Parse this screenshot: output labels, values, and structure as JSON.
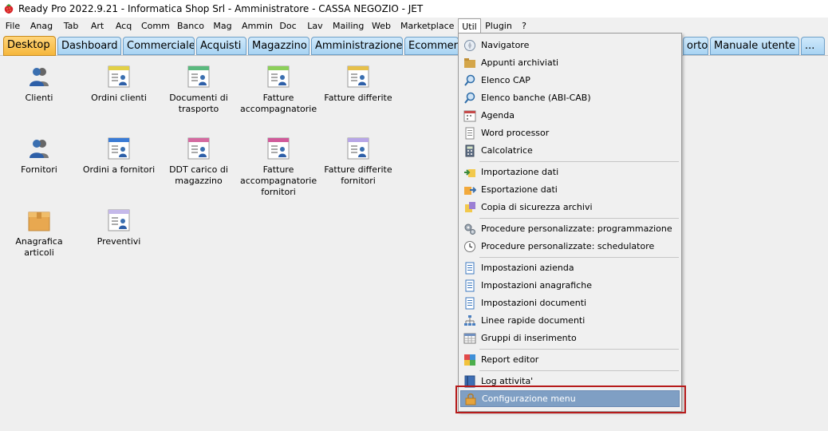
{
  "window": {
    "title": "Ready Pro 2022.9.21 - Informatica Shop Srl - Amministratore - CASSA NEGOZIO - JET"
  },
  "menubar": {
    "items": [
      "File",
      "Anag",
      "Tab",
      "Art",
      "Acq",
      "Comm",
      "Banco",
      "Mag",
      "Ammin",
      "Doc",
      "Lav",
      "Mailing",
      "Web",
      "Marketplace",
      "Util",
      "Plugin",
      "?"
    ],
    "open_item": "Util"
  },
  "tabs": {
    "items": [
      "Desktop",
      "Dashboard",
      "Commerciale",
      "Acquisti",
      "Magazzino",
      "Amministrazione",
      "Ecommerce",
      "orto",
      "Manuale utente",
      "..."
    ],
    "active": "Desktop"
  },
  "desktop": {
    "items": [
      {
        "label": "Clienti",
        "icon": "user-group-icon"
      },
      {
        "label": "Ordini clienti",
        "icon": "order-document-icon"
      },
      {
        "label": "Documenti di trasporto",
        "icon": "transport-document-icon"
      },
      {
        "label": "Fatture accompagnatorie",
        "icon": "invoice-document-icon"
      },
      {
        "label": "Fatture differite",
        "icon": "deferred-invoice-icon"
      },
      {
        "label": "Fornitori",
        "icon": "supplier-icon"
      },
      {
        "label": "Ordini a fornitori",
        "icon": "supplier-order-icon"
      },
      {
        "label": "DDT carico di magazzino",
        "icon": "warehouse-load-icon"
      },
      {
        "label": "Fatture accompagnatorie fornitori",
        "icon": "supplier-invoice-icon"
      },
      {
        "label": "Fatture differite fornitori",
        "icon": "supplier-deferred-invoice-icon"
      },
      {
        "label": "Anagrafica articoli",
        "icon": "box-icon"
      },
      {
        "label": "Preventivi",
        "icon": "quote-document-icon"
      }
    ]
  },
  "util_menu": {
    "items": [
      {
        "label": "Navigatore",
        "icon": "compass-icon"
      },
      {
        "label": "Appunti archiviati",
        "icon": "folder-icon"
      },
      {
        "label": "Elenco CAP",
        "icon": "magnifier-icon"
      },
      {
        "label": "Elenco banche (ABI-CAB)",
        "icon": "magnifier-icon"
      },
      {
        "label": "Agenda",
        "icon": "calendar-icon"
      },
      {
        "label": "Word processor",
        "icon": "document-icon"
      },
      {
        "label": "Calcolatrice",
        "icon": "calculator-icon"
      },
      {
        "label": "Importazione dati",
        "icon": "import-icon"
      },
      {
        "label": "Esportazione dati",
        "icon": "export-icon"
      },
      {
        "label": "Copia di sicurezza archivi",
        "icon": "backup-icon"
      },
      {
        "label": "Procedure personalizzate: programmazione",
        "icon": "gears-icon"
      },
      {
        "label": "Procedure personalizzate: schedulatore",
        "icon": "clock-icon"
      },
      {
        "label": "Impostazioni azienda",
        "icon": "settings-page-icon"
      },
      {
        "label": "Impostazioni anagrafiche",
        "icon": "settings-page-icon"
      },
      {
        "label": "Impostazioni documenti",
        "icon": "settings-page-icon"
      },
      {
        "label": "Linee rapide documenti",
        "icon": "hierarchy-icon"
      },
      {
        "label": "Gruppi di inserimento",
        "icon": "grid-icon"
      },
      {
        "label": "Report editor",
        "icon": "report-icon"
      },
      {
        "label": "Log attivita'",
        "icon": "log-book-icon"
      },
      {
        "label": "Configurazione menu",
        "icon": "lock-menu-icon"
      }
    ],
    "selected": "Configurazione menu"
  },
  "colors": {
    "tab_active": "#f6b73c",
    "tab_inactive": "#a8d4f3",
    "menu_selected": "#7f9fc4",
    "highlight_border": "#b61b1b"
  }
}
